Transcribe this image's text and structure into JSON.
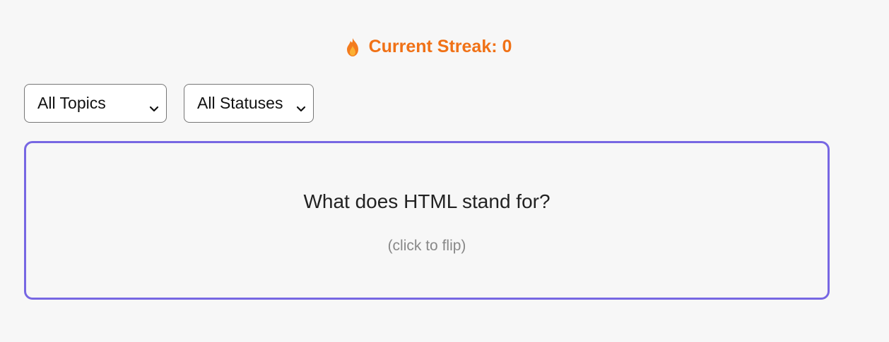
{
  "streak": {
    "icon": "fire-icon",
    "label": "Current Streak: 0",
    "color": "#f07116"
  },
  "filters": {
    "topic": {
      "selected": "All Topics"
    },
    "status": {
      "selected": "All Statuses"
    }
  },
  "flashcard": {
    "question": "What does HTML stand for?",
    "hint": "(click to flip)",
    "border_color": "#7767e3"
  }
}
